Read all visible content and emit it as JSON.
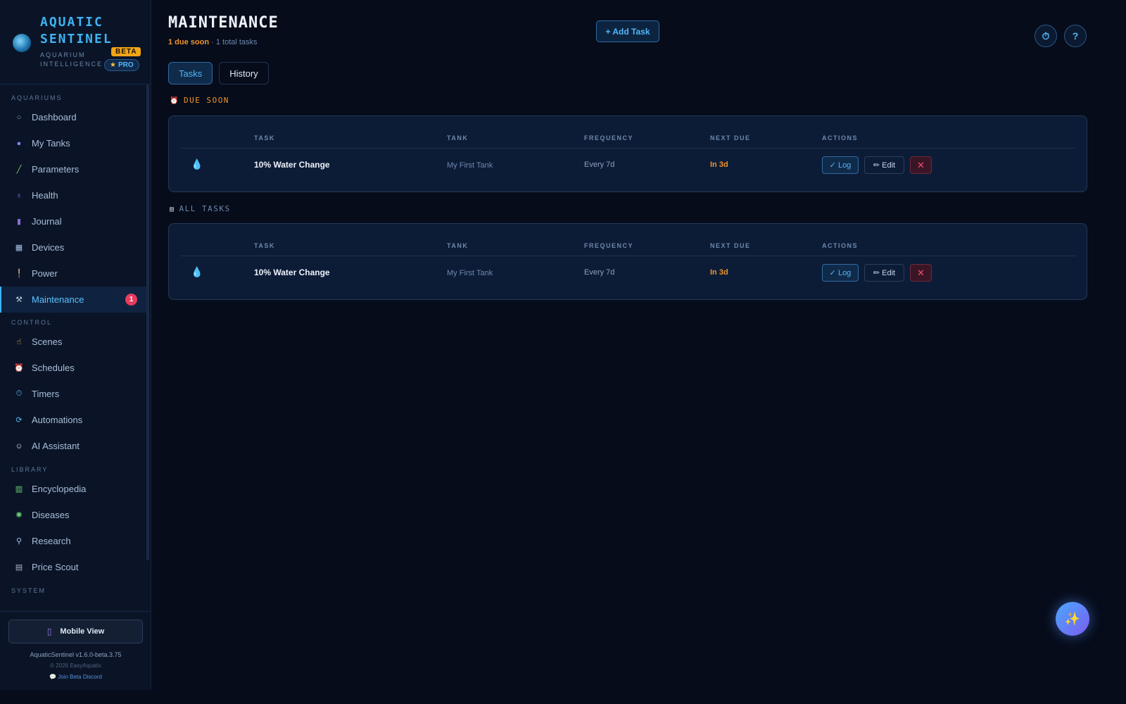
{
  "brand": {
    "title": "AQUATIC SENTINEL",
    "subtitle": "AQUARIUM INTELLIGENCE",
    "beta": "BETA",
    "pro": "PRO"
  },
  "sidebar": {
    "sections": {
      "aquariums": "AQUARIUMS",
      "control": "CONTROL",
      "library": "LIBRARY",
      "system": "SYSTEM"
    },
    "items": [
      {
        "label": "Dashboard",
        "icon": "circle-icon"
      },
      {
        "label": "My Tanks",
        "icon": "tank-icon"
      },
      {
        "label": "Parameters",
        "icon": "test-tube-icon"
      },
      {
        "label": "Health",
        "icon": "stethoscope-icon"
      },
      {
        "label": "Journal",
        "icon": "notebook-icon"
      },
      {
        "label": "Devices",
        "icon": "devices-icon"
      },
      {
        "label": "Power",
        "icon": "plug-icon"
      },
      {
        "label": "Maintenance",
        "icon": "wrench-icon",
        "badge": "1",
        "active": true
      },
      {
        "label": "Scenes",
        "icon": "hand-icon"
      },
      {
        "label": "Schedules",
        "icon": "alarm-clock-icon"
      },
      {
        "label": "Timers",
        "icon": "stopwatch-icon"
      },
      {
        "label": "Automations",
        "icon": "repeat-icon"
      },
      {
        "label": "AI Assistant",
        "icon": "robot-icon"
      },
      {
        "label": "Encyclopedia",
        "icon": "books-icon"
      },
      {
        "label": "Diseases",
        "icon": "microbe-icon"
      },
      {
        "label": "Research",
        "icon": "microscope-icon"
      },
      {
        "label": "Price Scout",
        "icon": "cash-register-icon"
      }
    ],
    "footer": {
      "mobile_view": "Mobile View",
      "version": "AquaticSentinel v1.6.0-beta.3.75",
      "copyright": "© 2026 EasyAquatix",
      "discord": "Join Beta Discord"
    }
  },
  "header": {
    "title": "MAINTENANCE",
    "due_soon": "1 due soon",
    "separator": " · ",
    "total": "1 total tasks",
    "add_task": "+ Add Task",
    "help": "?"
  },
  "tabs": [
    {
      "label": "Tasks",
      "active": true
    },
    {
      "label": "History",
      "active": false
    }
  ],
  "sections": {
    "due_soon": "DUE SOON",
    "all_tasks": "ALL TASKS"
  },
  "table": {
    "columns": [
      "TASK",
      "TANK",
      "FREQUENCY",
      "NEXT DUE",
      "ACTIONS"
    ],
    "due_rows": [
      {
        "task": "10% Water Change",
        "tank": "My First Tank",
        "frequency": "Every 7d",
        "next_due": "In 3d"
      }
    ],
    "all_rows": [
      {
        "task": "10% Water Change",
        "tank": "My First Tank",
        "frequency": "Every 7d",
        "next_due": "In 3d"
      }
    ],
    "actions": {
      "log": "✓ Log",
      "edit": "✏ Edit",
      "delete": "✕"
    }
  },
  "colors": {
    "accent": "#3fb3f2",
    "warning": "#f0932b",
    "danger": "#f0506e",
    "background": "#060c1a"
  }
}
